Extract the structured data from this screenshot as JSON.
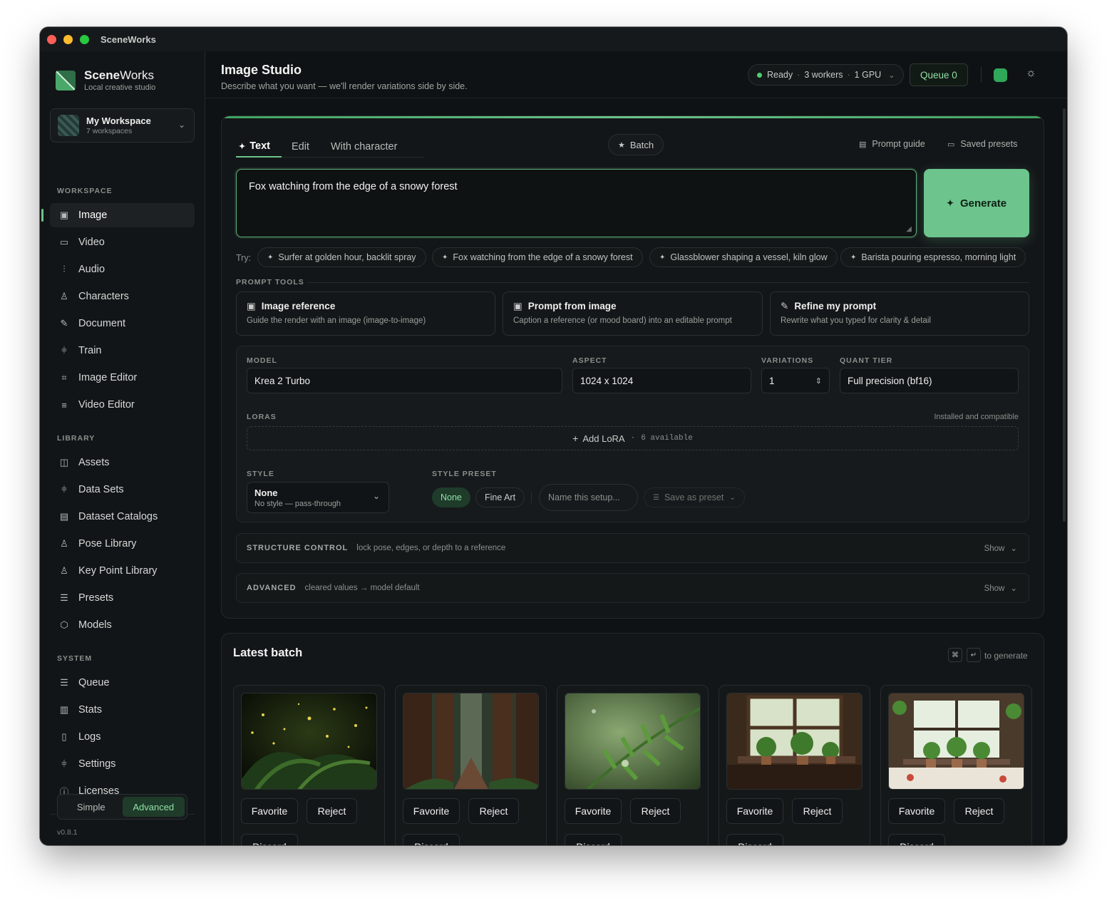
{
  "window": {
    "title": "SceneWorks"
  },
  "brand": {
    "name_bold": "Scene",
    "name_light": "Works",
    "subtitle": "Local creative studio"
  },
  "workspace": {
    "name": "My Workspace",
    "count": "7 workspaces"
  },
  "sidebar": {
    "workspace_label": "WORKSPACE",
    "workspace_items": [
      {
        "label": "Image",
        "icon": "image-icon"
      },
      {
        "label": "Video",
        "icon": "video-icon"
      },
      {
        "label": "Audio",
        "icon": "audio-wave-icon"
      },
      {
        "label": "Characters",
        "icon": "person-icon"
      },
      {
        "label": "Document",
        "icon": "pencil-icon"
      },
      {
        "label": "Train",
        "icon": "sliders-icon"
      },
      {
        "label": "Image Editor",
        "icon": "crop-icon"
      },
      {
        "label": "Video Editor",
        "icon": "timeline-icon"
      }
    ],
    "library_label": "LIBRARY",
    "library_items": [
      {
        "label": "Assets",
        "icon": "columns-icon"
      },
      {
        "label": "Data Sets",
        "icon": "sliders-icon"
      },
      {
        "label": "Dataset Catalogs",
        "icon": "document-icon"
      },
      {
        "label": "Pose Library",
        "icon": "person-icon"
      },
      {
        "label": "Key Point Library",
        "icon": "person-icon"
      },
      {
        "label": "Presets",
        "icon": "filter-icon"
      },
      {
        "label": "Models",
        "icon": "cube-icon"
      }
    ],
    "system_label": "SYSTEM",
    "system_items": [
      {
        "label": "Queue",
        "icon": "list-icon"
      },
      {
        "label": "Stats",
        "icon": "bar-chart-icon"
      },
      {
        "label": "Logs",
        "icon": "file-icon"
      },
      {
        "label": "Settings",
        "icon": "settings-sliders-icon"
      },
      {
        "label": "Licenses",
        "icon": "info-icon"
      }
    ],
    "mode": {
      "simple": "Simple",
      "advanced": "Advanced",
      "selected": "Advanced"
    },
    "version": "v0.8.1"
  },
  "header": {
    "title": "Image Studio",
    "subtitle": "Describe what you want — we'll render variations side by side.",
    "status": {
      "state": "Ready",
      "workers": "3 workers",
      "gpu": "1 GPU"
    },
    "queue": "Queue 0"
  },
  "studio": {
    "tabs": [
      "Text",
      "Edit",
      "With character"
    ],
    "active_tab": "Text",
    "batch": "Batch",
    "prompt_guide": "Prompt guide",
    "saved_presets": "Saved presets",
    "prompt_value": "Fox watching from the edge of a snowy forest",
    "generate": "Generate",
    "try_label": "Try:",
    "suggestions": [
      "Surfer at golden hour, backlit spray",
      "Fox watching from the edge of a snowy forest",
      "Glassblower shaping a vessel, kiln glow",
      "Barista pouring espresso, morning light"
    ],
    "tools_label": "PROMPT TOOLS",
    "tools": [
      {
        "title": "Image reference",
        "desc": "Guide the render with an image (image-to-image)",
        "icon": "image-icon"
      },
      {
        "title": "Prompt from image",
        "desc": "Caption a reference (or mood board) into an editable prompt",
        "icon": "image-icon"
      },
      {
        "title": "Refine my prompt",
        "desc": "Rewrite what you typed for clarity & detail",
        "icon": "pencil-icon"
      }
    ],
    "settings": {
      "model_label": "MODEL",
      "model": "Krea 2 Turbo",
      "aspect_label": "ASPECT",
      "aspect": "1024 x 1024",
      "variations_label": "VARIATIONS",
      "variations": "1",
      "quant_label": "QUANT TIER",
      "quant": "Full precision (bf16)",
      "loras_label": "LORAS",
      "loras_note": "Installed and compatible",
      "add_lora": "Add LoRA",
      "lora_available": "6 available",
      "style_label": "STYLE",
      "style_name": "None",
      "style_sub": "No style — pass-through",
      "preset_label": "STYLE PRESET",
      "preset_none": "None",
      "preset_fineart": "Fine Art",
      "preset_name_placeholder": "Name this setup...",
      "save_preset": "Save as preset"
    },
    "structure": {
      "title": "STRUCTURE CONTROL",
      "desc": "lock pose, edges, or depth to a reference",
      "show": "Show"
    },
    "advanced": {
      "title": "ADVANCED",
      "desc": "cleared values → model default",
      "show": "Show"
    }
  },
  "latest": {
    "title": "Latest batch",
    "kbd1": "⌘",
    "kbd2": "↵",
    "hint": "to generate",
    "items": [
      {
        "scene": "fern-fireflies",
        "favorite": "Favorite",
        "reject": "Reject",
        "discard": "Discard"
      },
      {
        "scene": "redwood-path",
        "favorite": "Favorite",
        "reject": "Reject",
        "discard": "Discard"
      },
      {
        "scene": "fern-dew",
        "favorite": "Favorite",
        "reject": "Reject",
        "discard": "Discard"
      },
      {
        "scene": "window-plants",
        "favorite": "Favorite",
        "reject": "Reject",
        "discard": "Discard"
      },
      {
        "scene": "window-herbs",
        "favorite": "Favorite",
        "reject": "Reject",
        "discard": "Discard"
      }
    ]
  },
  "colors": {
    "accent": "#6dc48c",
    "status_green": "#4ccf72",
    "background": "#0f1214"
  }
}
